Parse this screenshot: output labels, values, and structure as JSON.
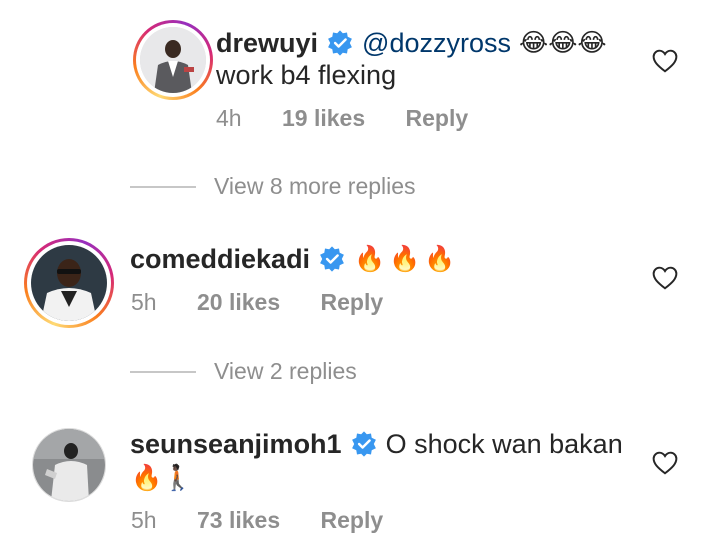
{
  "comments": [
    {
      "username": "drewuyi",
      "mention": "@dozzyross",
      "text": "",
      "text_line2": "work b4 flexing",
      "emoji": "😂😂😂",
      "time": "4h",
      "likes": "19 likes",
      "reply": "Reply"
    },
    {
      "username": "comeddiekadi",
      "mention": "",
      "text": "",
      "emoji": "🔥🔥🔥",
      "time": "5h",
      "likes": "20 likes",
      "reply": "Reply"
    },
    {
      "username": "seunseanjimoh1",
      "mention": "",
      "text": "O shock wan bakan",
      "emoji_line2": "🔥🚶🏿",
      "time": "5h",
      "likes": "73 likes",
      "reply": "Reply"
    }
  ],
  "view_replies": [
    {
      "label": "View 8 more replies"
    },
    {
      "label": "View 2 replies"
    }
  ],
  "colors": {
    "verified_blue": "#3897f0",
    "meta_gray": "#8e8e8e",
    "mention_blue": "#00376b"
  },
  "icons": {
    "verified": "verified-badge-icon",
    "heart": "heart-outline-icon"
  }
}
